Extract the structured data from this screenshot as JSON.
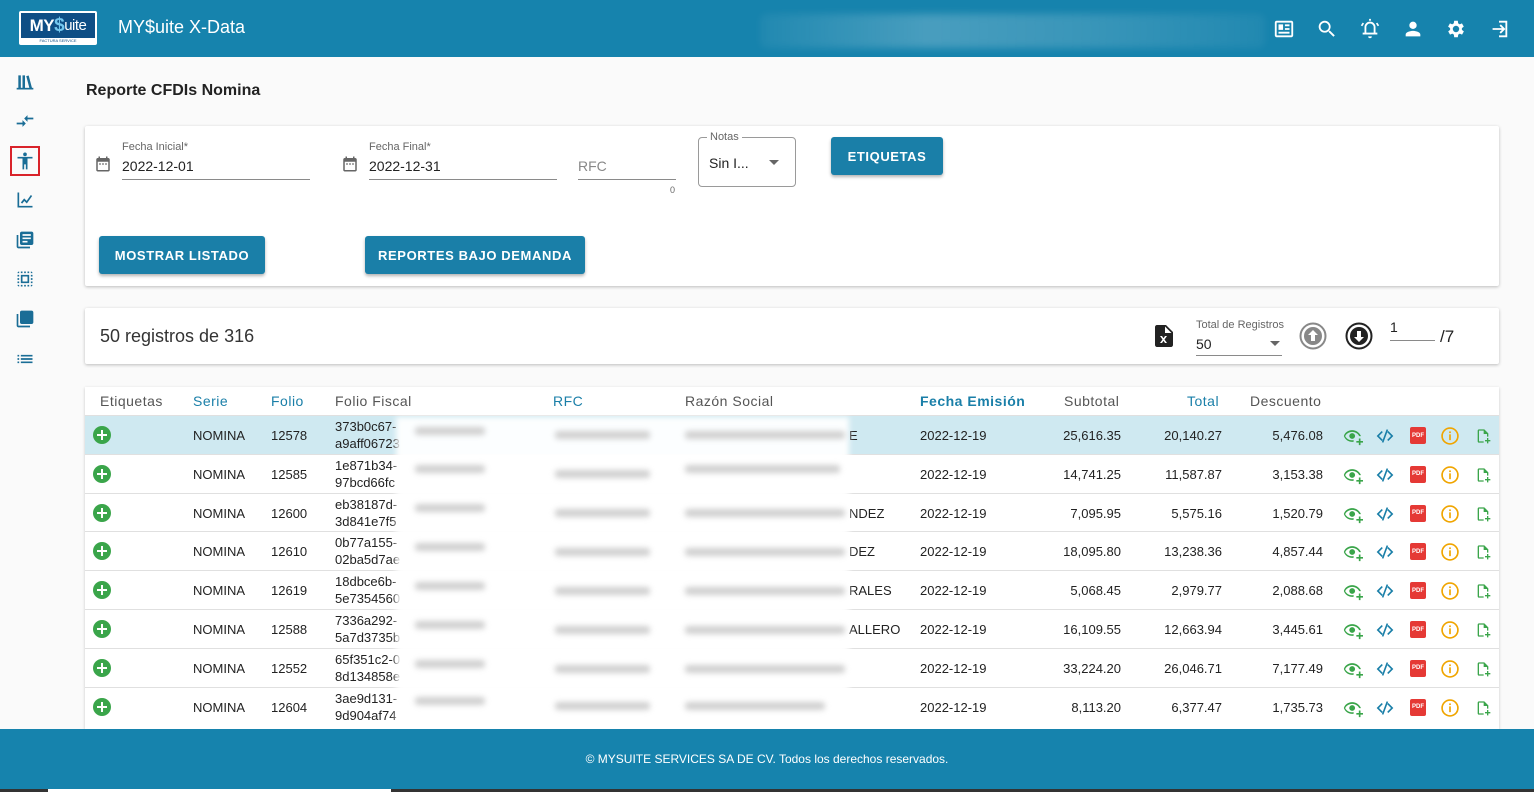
{
  "header": {
    "logo_text_my": "MY",
    "logo_text_s": "$",
    "logo_text_rest": "uite",
    "logo_tagline": "FACTURA SERVICE",
    "title": "MY$uite X-Data",
    "icons": [
      "news-icon",
      "search-icon",
      "alarm-icon",
      "user-icon",
      "settings-icon",
      "logout-icon"
    ]
  },
  "sidebar": {
    "items": [
      "library-icon",
      "compare-arrows-icon",
      "person-icon",
      "chart-icon",
      "list-book-icon",
      "copy-icon",
      "layers-icon",
      "list-icon"
    ],
    "active": "person-icon"
  },
  "page": {
    "title": "Reporte CFDIs Nomina"
  },
  "filters": {
    "fecha_inicial_label": "Fecha Inicial*",
    "fecha_inicial_value": "2022-12-01",
    "fecha_final_label": "Fecha Final*",
    "fecha_final_value": "2022-12-31",
    "rfc_placeholder": "RFC",
    "rfc_counter": "0",
    "notas_label": "Notas",
    "notas_value": "Sin I...",
    "etiquetas_button": "ETIQUETAS",
    "mostrar_button": "MOSTRAR LISTADO",
    "reportes_button": "REPORTES BAJO DEMANDA"
  },
  "summary": {
    "text": "50 registros de 316",
    "total_registros_label": "Total de Registros",
    "total_registros_value": "50",
    "page_current": "1",
    "page_total": "/7"
  },
  "table": {
    "headers": {
      "etiquetas": "Etiquetas",
      "serie": "Serie",
      "folio": "Folio",
      "folio_fiscal": "Folio Fiscal",
      "rfc": "RFC",
      "razon_social": "Razón Social",
      "fecha_emision": "Fecha Emisión",
      "subtotal": "Subtotal",
      "total": "Total",
      "descuento": "Descuento"
    },
    "rows": [
      {
        "serie": "NOMINA",
        "folio": "12578",
        "ff1": "373b0c67-",
        "ff2": "a9aff06723",
        "razon_tail": "E",
        "fecha": "2022-12-19",
        "subtotal": "25,616.35",
        "total": "20,140.27",
        "descuento": "5,476.08"
      },
      {
        "serie": "NOMINA",
        "folio": "12585",
        "ff1": "1e871b34-",
        "ff2": "97bcd66fc",
        "razon_tail": "",
        "fecha": "2022-12-19",
        "subtotal": "14,741.25",
        "total": "11,587.87",
        "descuento": "3,153.38"
      },
      {
        "serie": "NOMINA",
        "folio": "12600",
        "ff1": "eb38187d-",
        "ff2": "3d841e7f5",
        "razon_tail": "NDEZ",
        "fecha": "2022-12-19",
        "subtotal": "7,095.95",
        "total": "5,575.16",
        "descuento": "1,520.79"
      },
      {
        "serie": "NOMINA",
        "folio": "12610",
        "ff1": "0b77a155-",
        "ff2": "02ba5d7ae",
        "razon_tail": "DEZ",
        "fecha": "2022-12-19",
        "subtotal": "18,095.80",
        "total": "13,238.36",
        "descuento": "4,857.44"
      },
      {
        "serie": "NOMINA",
        "folio": "12619",
        "ff1": "18dbce6b-",
        "ff2": "5e7354560",
        "razon_tail": "RALES",
        "fecha": "2022-12-19",
        "subtotal": "5,068.45",
        "total": "2,979.77",
        "descuento": "2,088.68"
      },
      {
        "serie": "NOMINA",
        "folio": "12588",
        "ff1": "7336a292-",
        "ff2": "5a7d3735b",
        "razon_tail": "ALLERO",
        "fecha": "2022-12-19",
        "subtotal": "16,109.55",
        "total": "12,663.94",
        "descuento": "3,445.61"
      },
      {
        "serie": "NOMINA",
        "folio": "12552",
        "ff1": "65f351c2-0",
        "ff2": "8d134858e",
        "razon_tail": "",
        "fecha": "2022-12-19",
        "subtotal": "33,224.20",
        "total": "26,046.71",
        "descuento": "7,177.49"
      },
      {
        "serie": "NOMINA",
        "folio": "12604",
        "ff1": "3ae9d131-",
        "ff2": "9d904af74",
        "razon_tail": "",
        "fecha": "2022-12-19",
        "subtotal": "8,113.20",
        "total": "6,377.47",
        "descuento": "1,735.73"
      }
    ]
  },
  "footer": {
    "text": "© MYSUITE SERVICES SA DE CV. Todos los derechos reservados."
  },
  "colors": {
    "primary": "#1683ad",
    "button": "#1a7fa8",
    "selected_row": "#cfe9f1",
    "add_green": "#3aa54a",
    "pdf_red": "#e53935",
    "info_orange": "#f0a500",
    "xml_blue": "#1a7fa8"
  }
}
